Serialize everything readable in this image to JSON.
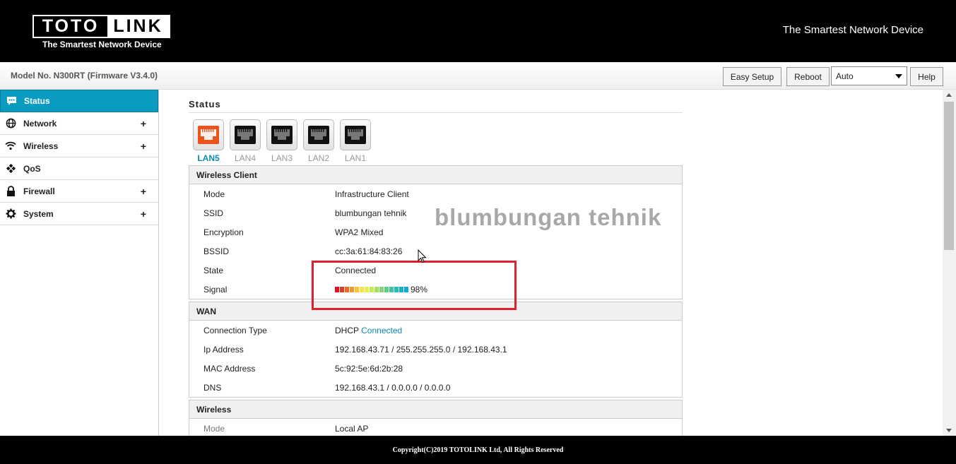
{
  "header": {
    "logo_left": "TOTO",
    "logo_right": "LINK",
    "logo_sub": "The Smartest Network Device",
    "tagline": "The Smartest Network Device"
  },
  "toolbar": {
    "model": "Model No. N300RT (Firmware V3.4.0)",
    "easy_setup": "Easy Setup",
    "reboot": "Reboot",
    "language": "Auto",
    "help": "Help"
  },
  "sidebar": {
    "items": [
      {
        "label": "Status",
        "icon": "chat-bubble-icon",
        "active": true
      },
      {
        "label": "Network",
        "icon": "globe-icon",
        "plus": "+"
      },
      {
        "label": "Wireless",
        "icon": "wifi-icon",
        "plus": "+"
      },
      {
        "label": "QoS",
        "icon": "qos-icon"
      },
      {
        "label": "Firewall",
        "icon": "lock-icon",
        "plus": "+"
      },
      {
        "label": "System",
        "icon": "gear-icon",
        "plus": "+"
      }
    ]
  },
  "main": {
    "title": "Status",
    "ports": [
      "LAN5",
      "LAN4",
      "LAN3",
      "LAN2",
      "LAN1"
    ],
    "active_port_color": "#e8541c",
    "wireless_client": {
      "title": "Wireless Client",
      "rows": [
        {
          "k": "Mode",
          "v": "Infrastructure Client"
        },
        {
          "k": "SSID",
          "v": "blumbungan tehnik"
        },
        {
          "k": "Encryption",
          "v": "WPA2 Mixed"
        },
        {
          "k": "BSSID",
          "v": "cc:3a:61:84:83:26"
        },
        {
          "k": "State",
          "v": "Connected"
        },
        {
          "k": "Signal",
          "v": "98%"
        }
      ],
      "signal_bar_colors": [
        "#d9142b",
        "#e23a25",
        "#ea6a28",
        "#f09833",
        "#f5c53c",
        "#f6e44a",
        "#e8ee52",
        "#c8e85a",
        "#a6de67",
        "#86d474",
        "#62cb86",
        "#3fc39b",
        "#26bcb2",
        "#16b3c7",
        "#12a9d6"
      ]
    },
    "wan": {
      "title": "WAN",
      "rows": [
        {
          "k": "Connection Type",
          "v": "DHCP",
          "v2": "Connected"
        },
        {
          "k": "Ip Address",
          "v": "192.168.43.71 / 255.255.255.0 / 192.168.43.1"
        },
        {
          "k": "MAC Address",
          "v": "5c:92:5e:6d:2b:28"
        },
        {
          "k": "DNS",
          "v": "192.168.43.1 / 0.0.0.0 / 0.0.0.0"
        }
      ]
    },
    "wireless": {
      "title": "Wireless",
      "rows": [
        {
          "k": "Mode",
          "v": "Local AP"
        }
      ]
    }
  },
  "watermark": "blumbungan tehnik",
  "footer": "Copyright(C)2019 TOTOLINK Ltd, All Rights Reserved"
}
